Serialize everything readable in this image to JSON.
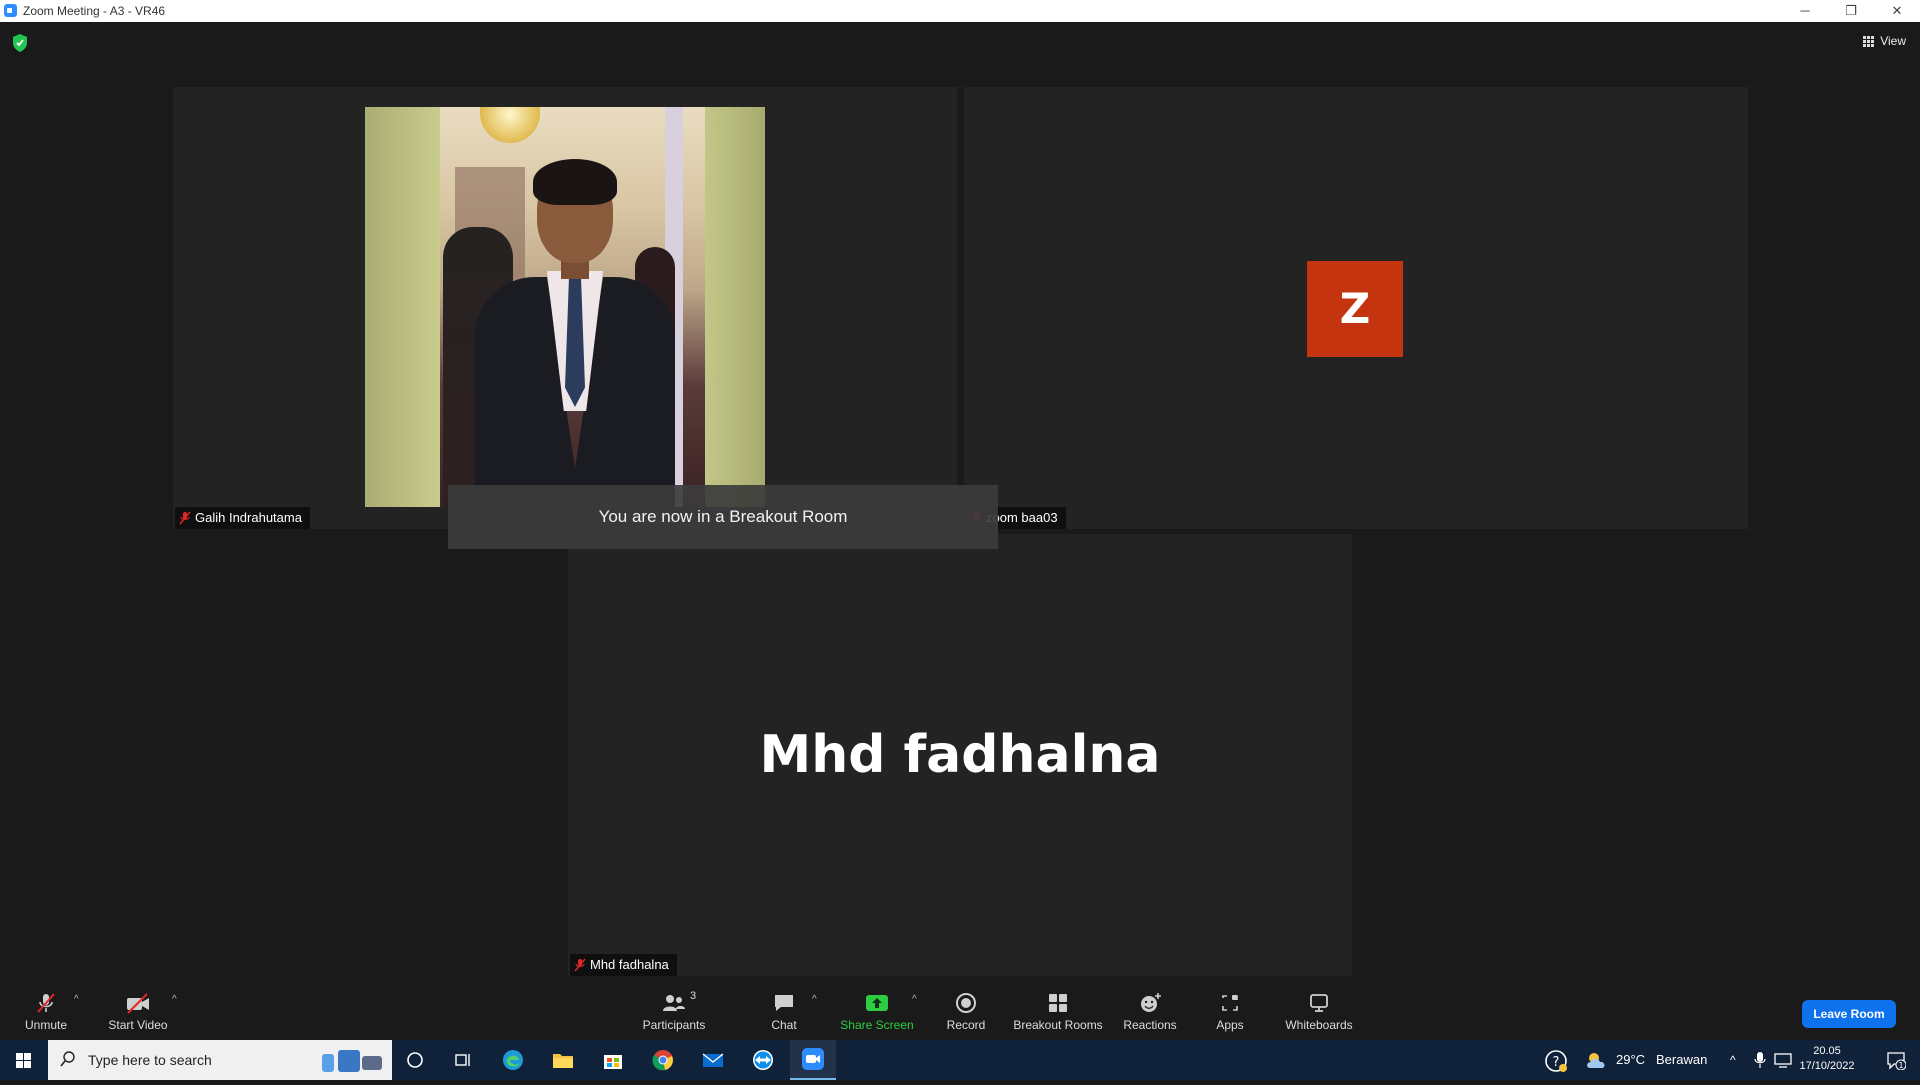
{
  "window": {
    "title": "Zoom Meeting - A3 - VR46",
    "minimize": "─",
    "maximize": "❐",
    "close": "✕"
  },
  "header": {
    "view_label": "View"
  },
  "participants": [
    {
      "name": "Galih Indrahutama",
      "muted": true,
      "video": "photo"
    },
    {
      "name": "zoom baa03",
      "muted": true,
      "avatar_letter": "Z",
      "avatar_color": "#c4340f"
    },
    {
      "name": "Mhd fadhalna",
      "muted": true,
      "display_name": "Mhd fadhalna"
    }
  ],
  "toast": {
    "message": "You are now in a Breakout Room"
  },
  "toolbar": {
    "unmute": "Unmute",
    "start_video": "Start Video",
    "participants": "Participants",
    "participants_count": "3",
    "chat": "Chat",
    "share_screen": "Share Screen",
    "record": "Record",
    "breakout_rooms": "Breakout Rooms",
    "reactions": "Reactions",
    "apps": "Apps",
    "whiteboards": "Whiteboards",
    "leave": "Leave Room",
    "share_color": "#2ecc40",
    "leave_color": "#0e72ed"
  },
  "taskbar": {
    "search_placeholder": "Type here to search",
    "weather_temp": "29°C",
    "weather_desc": "Berawan",
    "time": "20.05",
    "date": "17/10/2022",
    "notification_count": "1",
    "apps": [
      "cortana-icon",
      "task-view-icon",
      "edge-icon",
      "file-explorer-icon",
      "store-icon",
      "chrome-icon",
      "mail-icon",
      "teamviewer-icon",
      "zoom-icon"
    ]
  }
}
